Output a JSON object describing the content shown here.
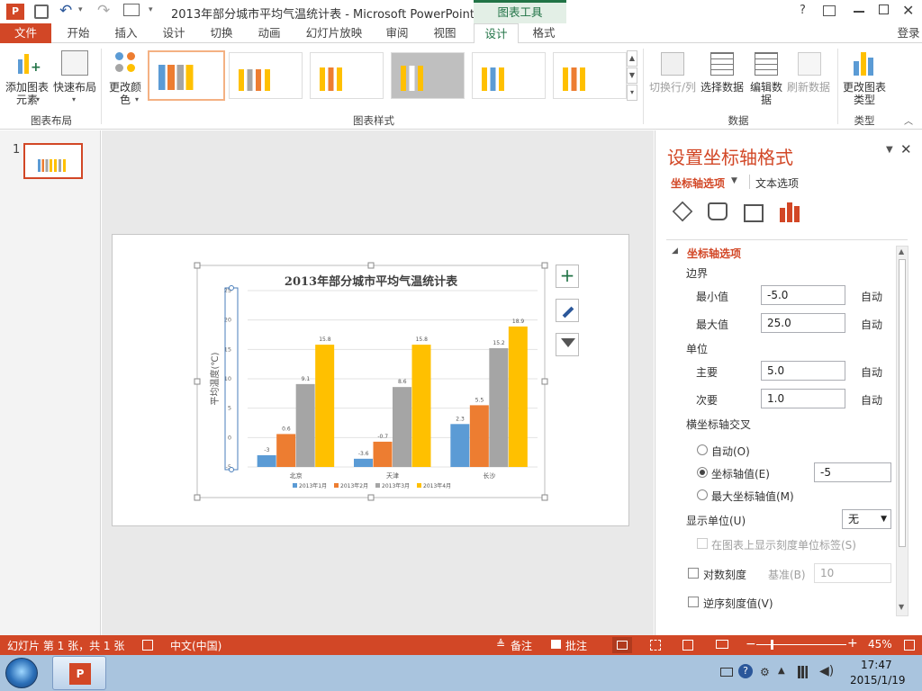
{
  "titlebar": {
    "title": "2013年部分城市平均气温统计表 - Microsoft PowerPoint",
    "context_group": "图表工具",
    "help": "?",
    "signin": "登录"
  },
  "tabs": [
    "文件",
    "开始",
    "插入",
    "设计",
    "切换",
    "动画",
    "幻灯片放映",
    "审阅",
    "视图",
    "设计",
    "格式"
  ],
  "ribbon": {
    "add_element": "添加图表元素",
    "quick_layout": "快速布局",
    "group_layout": "图表布局",
    "change_color": "更改颜色",
    "group_styles": "图表样式",
    "switch_row_col": "切换行/列",
    "select_data": "选择数据",
    "edit_data": "编辑数据",
    "refresh_data": "刷新数据",
    "group_data": "数据",
    "change_type": "更改图表类型",
    "group_type": "类型"
  },
  "slides": {
    "number": "1"
  },
  "chart_data": {
    "type": "bar",
    "title": "2013年部分城市平均气温统计表",
    "ylabel": "平均温度(℃)",
    "categories": [
      "北京",
      "天津",
      "长沙"
    ],
    "ylim": [
      -5,
      25
    ],
    "yticks": [
      "25",
      "20",
      "15",
      "10",
      "5",
      "0",
      "-5"
    ],
    "series": [
      {
        "name": "2013年1月",
        "color": "#5b9bd5",
        "values": [
          -3,
          -3.6,
          2.3
        ],
        "labels": [
          "-3",
          "-3.6",
          "2.3"
        ]
      },
      {
        "name": "2013年2月",
        "color": "#ed7d31",
        "values": [
          0.6,
          -0.7,
          5.5
        ],
        "labels": [
          "0.6",
          "-0.7",
          "5.5"
        ]
      },
      {
        "name": "2013年3月",
        "color": "#a5a5a5",
        "values": [
          9.1,
          8.6,
          15.2
        ],
        "labels": [
          "9.1",
          "8.6",
          "15.2"
        ]
      },
      {
        "name": "2013年4月",
        "color": "#ffc000",
        "values": [
          15.8,
          15.8,
          18.9
        ],
        "labels": [
          "15.8",
          "15.8",
          "18.9"
        ]
      }
    ]
  },
  "format_pane": {
    "title": "设置坐标轴格式",
    "tab_axis": "坐标轴选项",
    "tab_text": "文本选项",
    "section": "坐标轴选项",
    "bounds": "边界",
    "min_label": "最小值",
    "min_value": "-5.0",
    "max_label": "最大值",
    "max_value": "25.0",
    "auto": "自动",
    "units": "单位",
    "major_label": "主要",
    "major_value": "5.0",
    "minor_label": "次要",
    "minor_value": "1.0",
    "cross": "横坐标轴交叉",
    "opt_auto": "自动(O)",
    "opt_axis_value": "坐标轴值(E)",
    "axis_value": "-5",
    "opt_max": "最大坐标轴值(M)",
    "display_units": "显示单位(U)",
    "display_units_value": "无",
    "show_units_label": "在图表上显示刻度单位标签(S)",
    "log_scale": "对数刻度",
    "base": "基准(B)",
    "base_value": "10",
    "reverse": "逆序刻度值(V)"
  },
  "statusbar": {
    "slide_info": "幻灯片 第 1 张，共 1 张",
    "language": "中文(中国)",
    "notes": "备注",
    "comments": "批注",
    "zoom": "45%"
  },
  "taskbar": {
    "time": "17:47",
    "date": "2015/1/19"
  },
  "colors": {
    "accent": "#d24726",
    "chart_tools": "#217346"
  }
}
